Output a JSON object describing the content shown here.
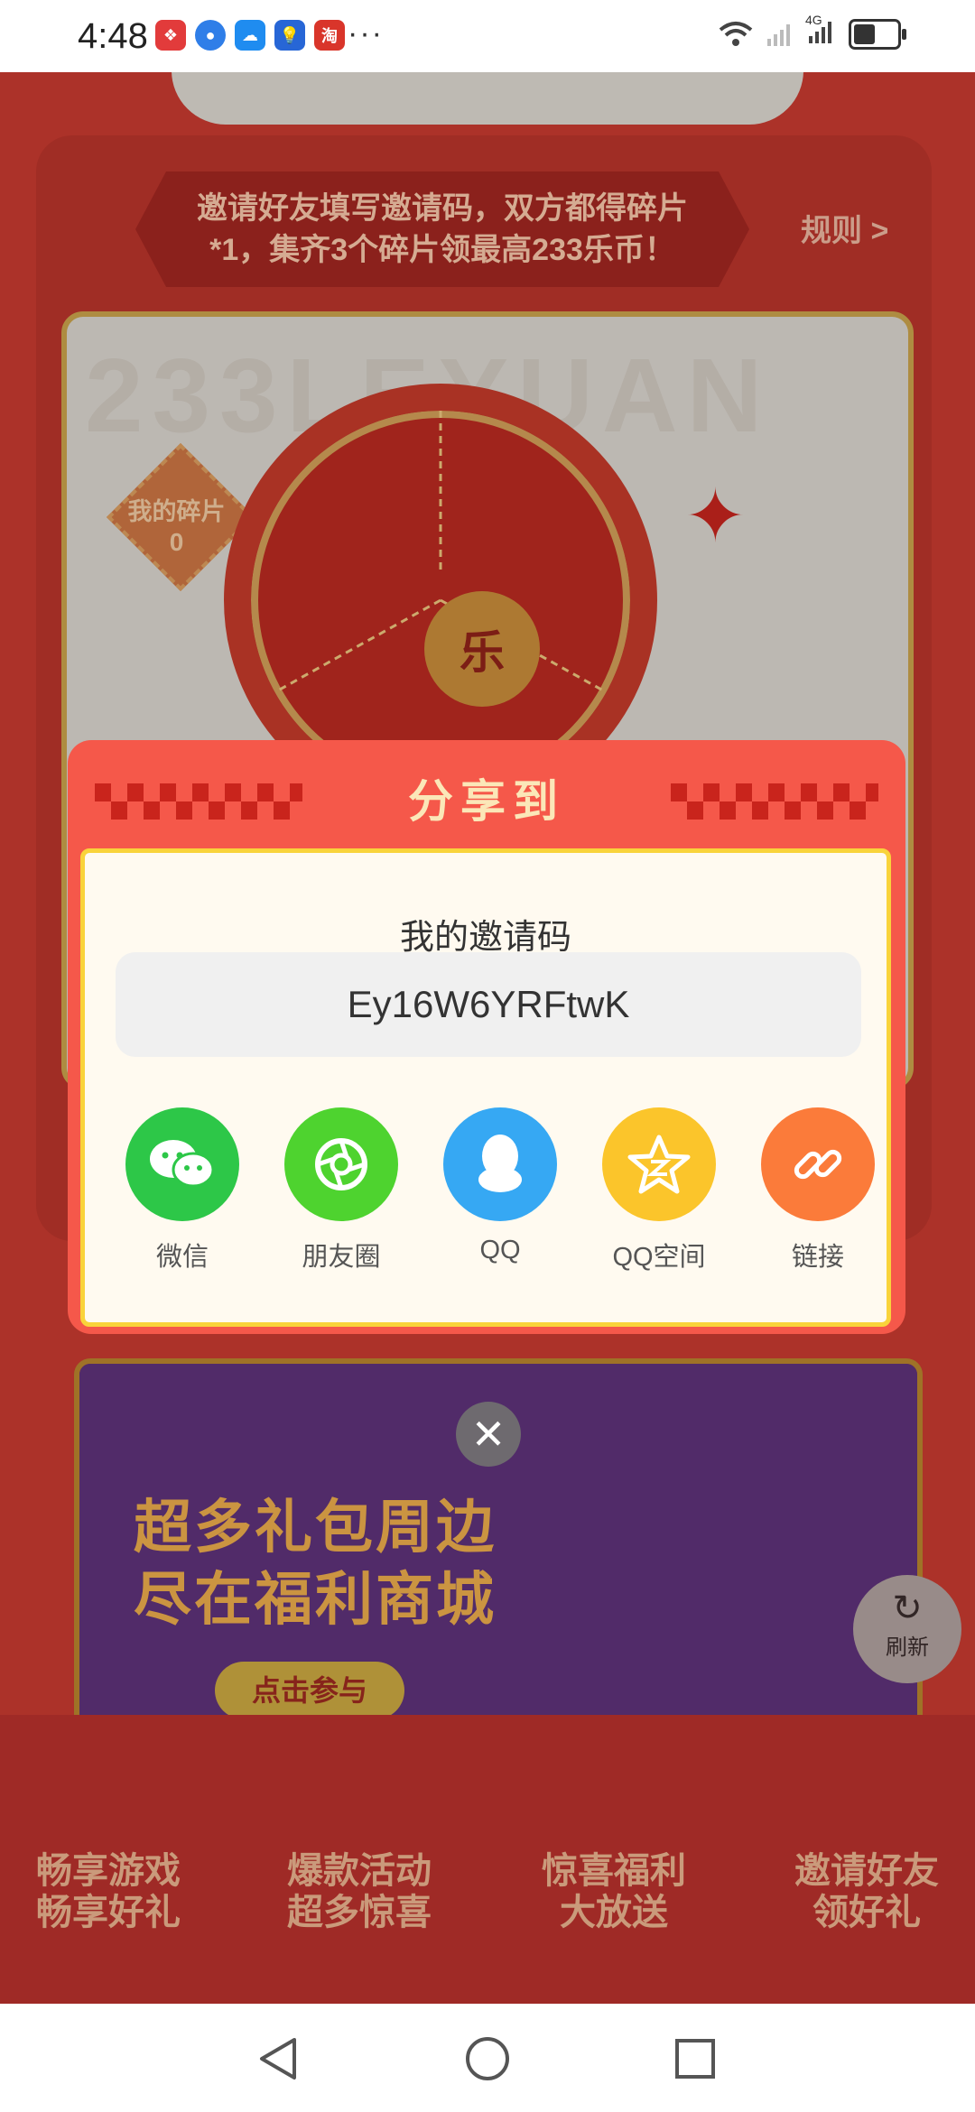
{
  "status_bar": {
    "time": "4:48",
    "notification_icons": [
      "app-icon-1",
      "browser-icon",
      "weather-icon",
      "idea-icon",
      "taobao-icon"
    ],
    "more": "···",
    "network": "4G"
  },
  "background": {
    "banner_line1": "邀请好友填写邀请码，双方都得碎片",
    "banner_line2": "*1，集齐3个碎片领最高233乐币！",
    "rules_link": "规则 >",
    "watermark": "233LEYUAN",
    "my_shards_label": "我的碎片",
    "my_shards_count": "0",
    "wheel_center": "乐",
    "shop_title_line1": "超多礼包周边",
    "shop_title_line2": "尽在福利商城",
    "shop_button": "点击参与",
    "refresh_label": "刷新",
    "features": [
      {
        "line1": "畅享游戏",
        "line2": "畅享好礼"
      },
      {
        "line1": "爆款活动",
        "line2": "超多惊喜"
      },
      {
        "line1": "惊喜福利",
        "line2": "大放送"
      },
      {
        "line1": "邀请好友",
        "line2": "领好礼"
      }
    ]
  },
  "share_dialog": {
    "title": "分享到",
    "code_label": "我的邀请码",
    "invite_code": "Ey16W6YRFtwK",
    "targets": [
      {
        "label": "微信",
        "icon": "wechat-icon",
        "color": "#2dc748"
      },
      {
        "label": "朋友圈",
        "icon": "moments-icon",
        "color": "#4ed32f"
      },
      {
        "label": "QQ",
        "icon": "qq-icon",
        "color": "#36a8f3"
      },
      {
        "label": "QQ空间",
        "icon": "qzone-icon",
        "color": "#fbc52b"
      },
      {
        "label": "链接",
        "icon": "link-icon",
        "color": "#fb7b3a"
      }
    ],
    "close": "✕"
  }
}
